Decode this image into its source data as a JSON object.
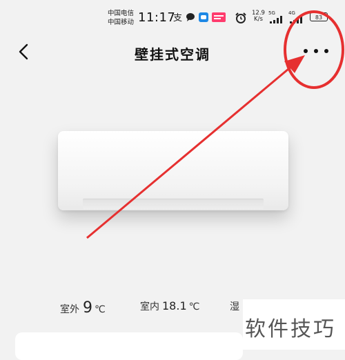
{
  "status_bar": {
    "carrier_1": "中国电信",
    "carrier_2": "中国移动",
    "time": "11:17",
    "speed_value": "12.9",
    "speed_unit": "K/s",
    "network_1": "5G",
    "network_2": "4G",
    "battery": "83",
    "icons": [
      "alipay-icon",
      "chat-bubble-icon",
      "app-icon",
      "app-badge-icon",
      "alarm-icon",
      "signal-icon",
      "signal-icon",
      "battery-icon"
    ]
  },
  "header": {
    "title": "壁挂式空调",
    "back_icon": "chevron-left-icon",
    "more_icon": "more-horizontal-icon"
  },
  "readings": {
    "outdoor_label": "室外",
    "outdoor_value": "9",
    "outdoor_unit": "℃",
    "indoor_label": "室内",
    "indoor_value": "18.1",
    "indoor_unit": "℃",
    "humidity_label": "湿"
  },
  "watermark": {
    "text": "软件技巧"
  },
  "colors": {
    "background": "#f2f2f2",
    "annotation": "#e63030",
    "text": "#111111"
  }
}
